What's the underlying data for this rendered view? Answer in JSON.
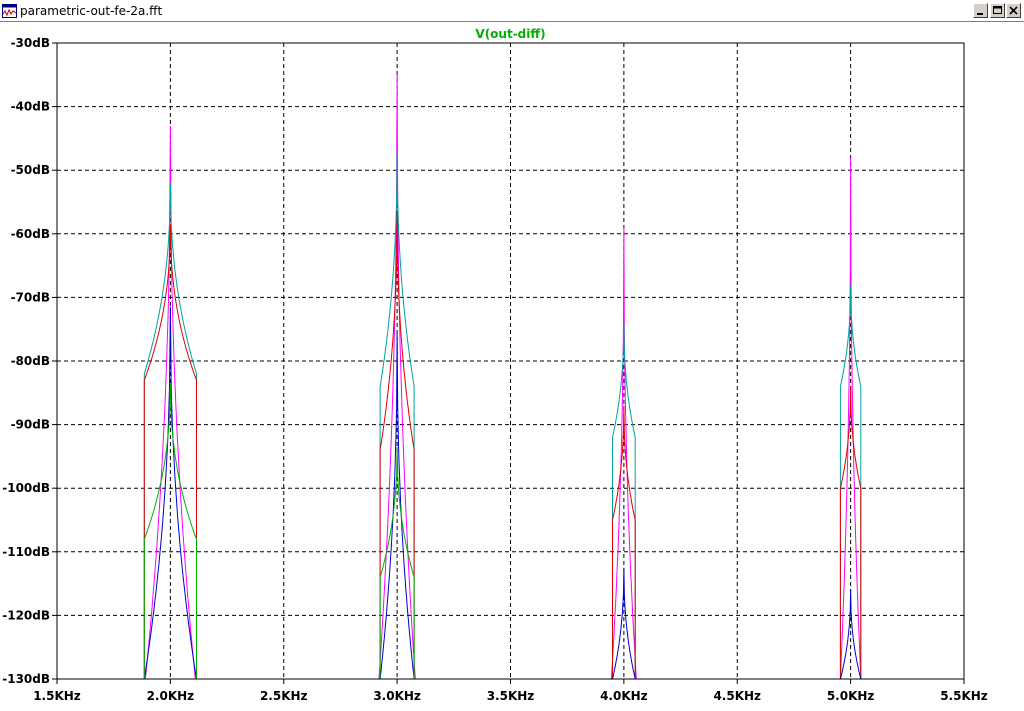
{
  "window": {
    "title": "parametric-out-fe-2a.fft",
    "app_icon": "waveform-icon",
    "buttons": [
      "minimize-icon",
      "maximize-icon",
      "close-icon"
    ]
  },
  "colors": {
    "plot_background": "#ffffff",
    "grid": "#000000",
    "series_title": "#00b000"
  },
  "chart_data": {
    "type": "line",
    "title": "V(out-diff)",
    "xlabel": "",
    "ylabel": "",
    "xlim": [
      1.5,
      5.5
    ],
    "ylim": [
      -130,
      -30
    ],
    "x_ticks": [
      1.5,
      2.0,
      2.5,
      3.0,
      3.5,
      4.0,
      4.5,
      5.0,
      5.5
    ],
    "x_tick_labels": [
      "1.5KHz",
      "2.0KHz",
      "2.5KHz",
      "3.0KHz",
      "3.5KHz",
      "4.0KHz",
      "4.5KHz",
      "5.0KHz",
      "5.5KHz"
    ],
    "y_ticks": [
      -30,
      -40,
      -50,
      -60,
      -70,
      -80,
      -90,
      -100,
      -110,
      -120,
      -130
    ],
    "y_tick_labels": [
      "-30dB",
      "-40dB",
      "-50dB",
      "-60dB",
      "-70dB",
      "-80dB",
      "-90dB",
      "-100dB",
      "-110dB",
      "-120dB",
      "-130dB"
    ],
    "grid": true,
    "legend": "none",
    "series": [
      {
        "color": "#ff00ff",
        "peaks": [
          {
            "center": 2.0,
            "peak": -43,
            "half_width": 0.11,
            "edge": -130
          },
          {
            "center": 3.0,
            "peak": -35,
            "half_width": 0.08,
            "edge": -130
          },
          {
            "center": 4.0,
            "peak": -59,
            "half_width": 0.055,
            "edge": -130
          },
          {
            "center": 5.0,
            "peak": -48,
            "half_width": 0.045,
            "edge": -130
          }
        ]
      },
      {
        "color": "#00a0a0",
        "peaks": [
          {
            "center": 2.0,
            "peak": -52,
            "half_width": 0.115,
            "edge": -82
          },
          {
            "center": 3.0,
            "peak": -47,
            "half_width": 0.075,
            "edge": -84
          },
          {
            "center": 4.0,
            "peak": -74,
            "half_width": 0.05,
            "edge": -92
          },
          {
            "center": 5.0,
            "peak": -68,
            "half_width": 0.045,
            "edge": -84
          }
        ]
      },
      {
        "color": "#e00000",
        "peaks": [
          {
            "center": 2.0,
            "peak": -58.5,
            "half_width": 0.115,
            "edge": -83
          },
          {
            "center": 3.0,
            "peak": -56.5,
            "half_width": 0.075,
            "edge": -94
          },
          {
            "center": 4.0,
            "peak": -87,
            "half_width": 0.05,
            "edge": -105
          },
          {
            "center": 5.0,
            "peak": -84,
            "half_width": 0.045,
            "edge": -100
          }
        ]
      },
      {
        "color": "#0000d0",
        "peaks": [
          {
            "center": 2.0,
            "peak": -71.5,
            "half_width": 0.115,
            "edge": -130
          },
          {
            "center": 3.0,
            "peak": -75.5,
            "half_width": 0.075,
            "edge": -130
          },
          {
            "center": 4.0,
            "peak": -112.5,
            "half_width": 0.05,
            "edge": -130
          },
          {
            "center": 5.0,
            "peak": -116,
            "half_width": 0.045,
            "edge": -130
          }
        ]
      },
      {
        "color": "#00b000",
        "peaks": [
          {
            "center": 2.0,
            "peak": -83.5,
            "half_width": 0.115,
            "edge": -108
          },
          {
            "center": 3.0,
            "peak": -93.5,
            "half_width": 0.075,
            "edge": -114
          }
        ]
      }
    ]
  }
}
